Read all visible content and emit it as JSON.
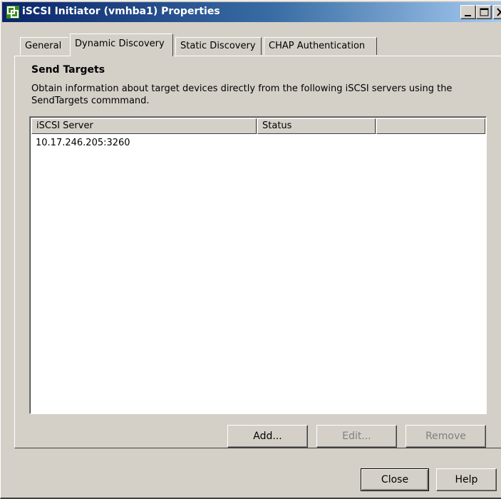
{
  "window": {
    "title": "iSCSI Initiator (vmhba1) Properties"
  },
  "tabs": [
    {
      "label": "General",
      "active": false
    },
    {
      "label": "Dynamic Discovery",
      "active": true
    },
    {
      "label": "Static Discovery",
      "active": false
    },
    {
      "label": "CHAP Authentication",
      "active": false
    }
  ],
  "send_targets": {
    "heading": "Send Targets",
    "description": "Obtain information about target devices directly from the following iSCSI servers using the SendTargets commmand.",
    "columns": [
      "iSCSI Server",
      "Status",
      ""
    ],
    "rows": [
      {
        "server": "10.17.246.205:3260",
        "status": ""
      }
    ]
  },
  "buttons": {
    "add": "Add...",
    "edit": "Edit...",
    "remove": "Remove",
    "close": "Close",
    "help": "Help"
  },
  "colors": {
    "titlebar_start": "#0a246a",
    "titlebar_end": "#a6caf0",
    "face": "#d4d0c8"
  }
}
